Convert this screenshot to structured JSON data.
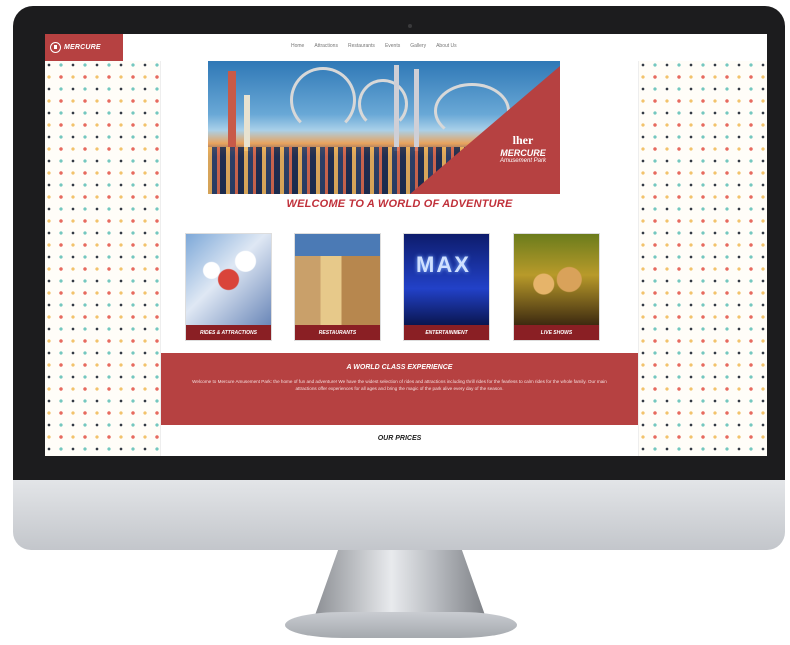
{
  "site": {
    "logo_text": "MERCURE",
    "accent_color": "#b64141",
    "dark_red": "#8a1f24"
  },
  "nav": {
    "items": [
      "Home",
      "Attractions",
      "Restaurants",
      "Events",
      "Gallery",
      "About Us"
    ]
  },
  "hero": {
    "brand": "lher",
    "park_name": "MERCURE",
    "park_sub": "Amusement Park"
  },
  "headline": "WELCOME TO A WORLD OF ADVENTURE",
  "cards": [
    {
      "label": "RIDES & ATTRACTIONS",
      "image": "rides-photo"
    },
    {
      "label": "RESTAURANTS",
      "image": "restaurant-photo"
    },
    {
      "label": "ENTERTAINMENT",
      "image": "imax-photo",
      "overlay_text": "MAX"
    },
    {
      "label": "LIVE SHOWS",
      "image": "concert-photo"
    }
  ],
  "experience": {
    "title": "A WORLD CLASS EXPERIENCE",
    "body": "Welcome to Mercure Amusement Park: the home of fun and adventure! We have the widest selection of rides and attractions including thrill rides for the fearless to calm rides for the whole family. Our main attractions offer experiences for all ages and bring the magic of the park alive every day of the season."
  },
  "prices_heading": "OUR PRICES"
}
